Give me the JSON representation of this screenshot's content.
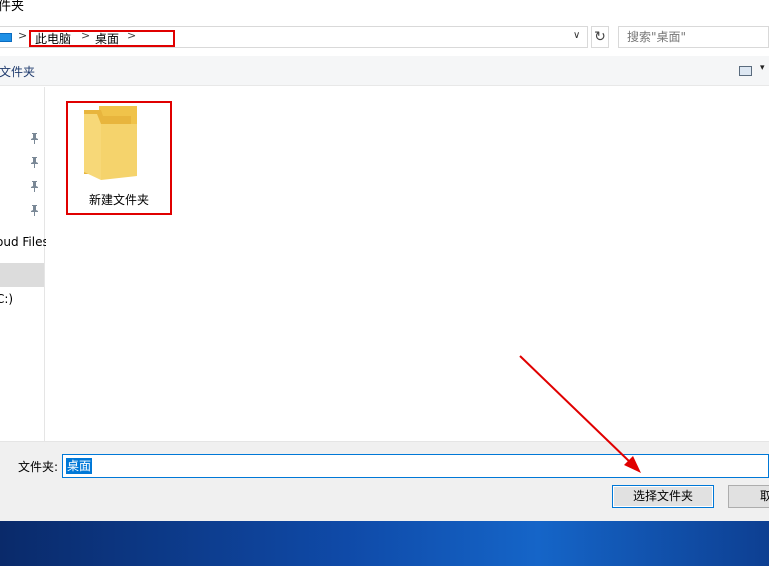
{
  "window": {
    "title": "件夹"
  },
  "address": {
    "crumbs": [
      "此电脑",
      "桌面"
    ],
    "sep": ">",
    "dropdown": "∨",
    "refresh": "↻"
  },
  "search": {
    "placeholder": "搜索\"桌面\""
  },
  "toolbar": {
    "new_folder": "文件夹",
    "view_dropdown": "▾"
  },
  "nav": {
    "pin_glyph": "📌",
    "items": [
      "oud Files",
      "C:)"
    ]
  },
  "content": {
    "items": [
      {
        "label": "新建文件夹",
        "icon": "folder-icon"
      }
    ]
  },
  "footer": {
    "folder_label": "文件夹:",
    "folder_value": "桌面",
    "select_button": "选择文件夹",
    "cancel_button": "取消"
  },
  "colors": {
    "highlight": "#e00000",
    "accent": "#0078d7",
    "folder": "#f5d36c"
  }
}
